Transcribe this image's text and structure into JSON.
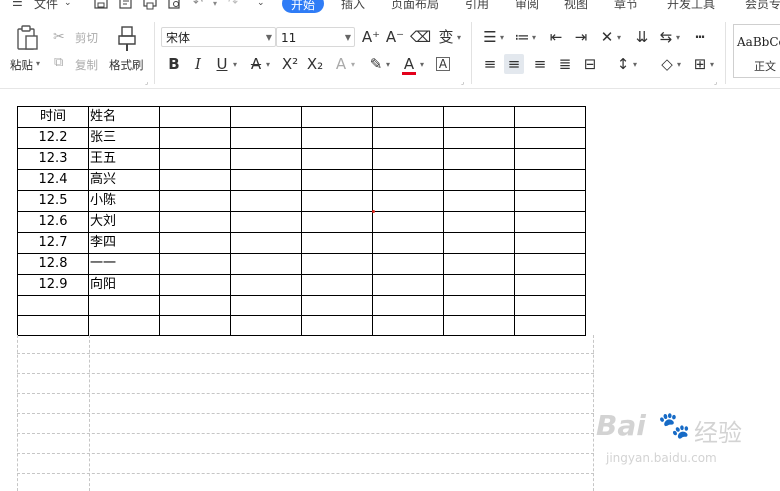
{
  "menu": {
    "file": "文件",
    "tabs": [
      "开始",
      "插入",
      "页面布局",
      "引用",
      "审阅",
      "视图",
      "章节",
      "开发工具",
      "会员专享"
    ],
    "active_tab": "开始",
    "accent": "#2f7cf6"
  },
  "ribbon": {
    "paste": "粘贴",
    "cut": "剪切",
    "copy": "复制",
    "format_painter": "格式刷",
    "font_name": "宋体",
    "font_size": "11",
    "style_sample": "AaBbCc",
    "style_name": "正文"
  },
  "table": {
    "rows": [
      [
        "时间",
        "姓名",
        "",
        "",
        "",
        "",
        "",
        ""
      ],
      [
        "12.2",
        "张三",
        "",
        "",
        "",
        "",
        "",
        ""
      ],
      [
        "12.3",
        "王五",
        "",
        "",
        "",
        "",
        "",
        ""
      ],
      [
        "12.4",
        "高兴",
        "",
        "",
        "",
        "",
        "",
        ""
      ],
      [
        "12.5",
        "小陈",
        "",
        "",
        "",
        "",
        "",
        ""
      ],
      [
        "12.6",
        "大刘",
        "",
        "",
        "",
        "",
        "",
        ""
      ],
      [
        "12.7",
        "李四",
        "",
        "",
        "",
        "",
        "",
        ""
      ],
      [
        "12.8",
        "一一",
        "",
        "",
        "",
        "",
        "",
        ""
      ],
      [
        "12.9",
        "向阳",
        "",
        "",
        "",
        "",
        "",
        ""
      ],
      [
        "",
        "",
        "",
        "",
        "",
        "",
        "",
        ""
      ],
      [
        "",
        "",
        "",
        "",
        "",
        "",
        "",
        ""
      ]
    ]
  },
  "watermark": {
    "brand": "Bai",
    "brand_suffix": "经验",
    "url": "jingyan.baidu.com"
  }
}
